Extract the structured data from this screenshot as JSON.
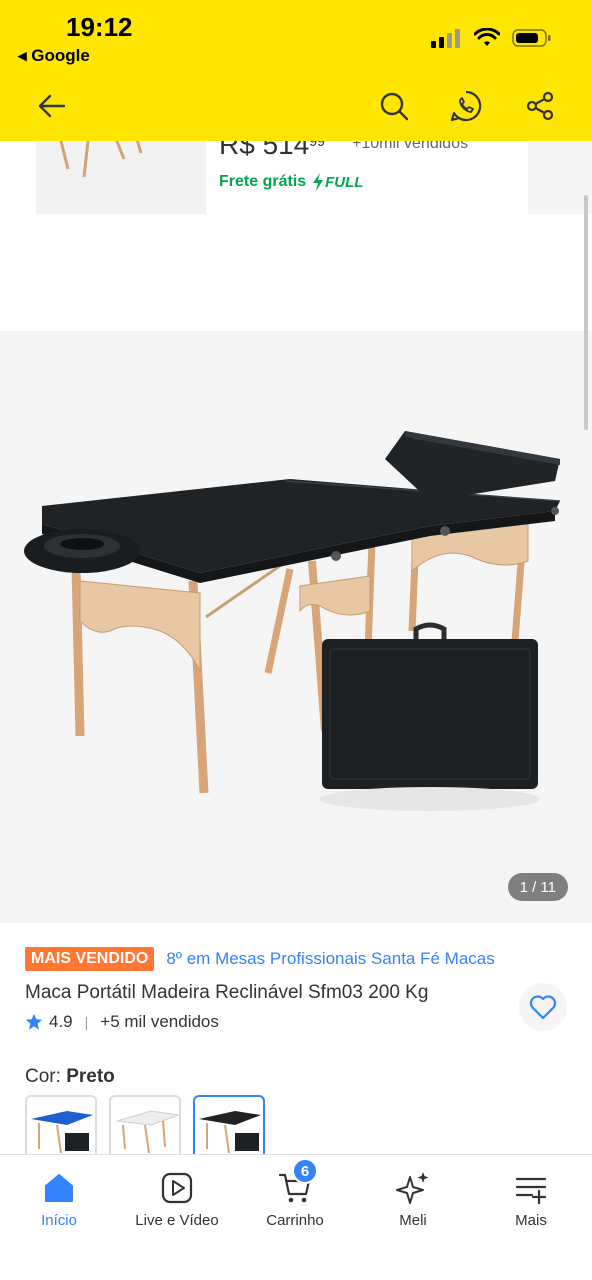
{
  "status_bar": {
    "time": "19:12",
    "back_app": "◂ Google"
  },
  "previous_item": {
    "price_int": "R$ 514",
    "price_cents": "99",
    "sold": "+10mil vendidos",
    "shipping": "Frete grátis",
    "full_label": "FULL"
  },
  "gallery": {
    "counter": "1 / 11"
  },
  "product": {
    "badge": "MAIS VENDIDO",
    "ranking": "8º em Mesas Profissionais Santa Fé Macas",
    "title": "Maca Portátil Madeira Reclinável Sfm03 200 Kg",
    "rating": "4.9",
    "sold": "+5 mil vendidos",
    "color_label": "Cor:",
    "color_value": "Preto",
    "color_options": [
      "blue",
      "white",
      "black"
    ],
    "selected_color": "black"
  },
  "tabbar": {
    "items": [
      {
        "label": "Início",
        "icon": "home-icon",
        "active": true
      },
      {
        "label": "Live e Vídeo",
        "icon": "play-icon",
        "active": false
      },
      {
        "label": "Carrinho",
        "icon": "cart-icon",
        "active": false
      },
      {
        "label": "Meli",
        "icon": "sparkle-icon",
        "active": false
      },
      {
        "label": "Mais",
        "icon": "menu-icon",
        "active": false
      }
    ],
    "cart_count": "6"
  },
  "colors": {
    "brand_yellow": "#FFE600",
    "accent_blue": "#3483FA",
    "badge_orange": "#FF7733",
    "shipping_green": "#00A650"
  }
}
